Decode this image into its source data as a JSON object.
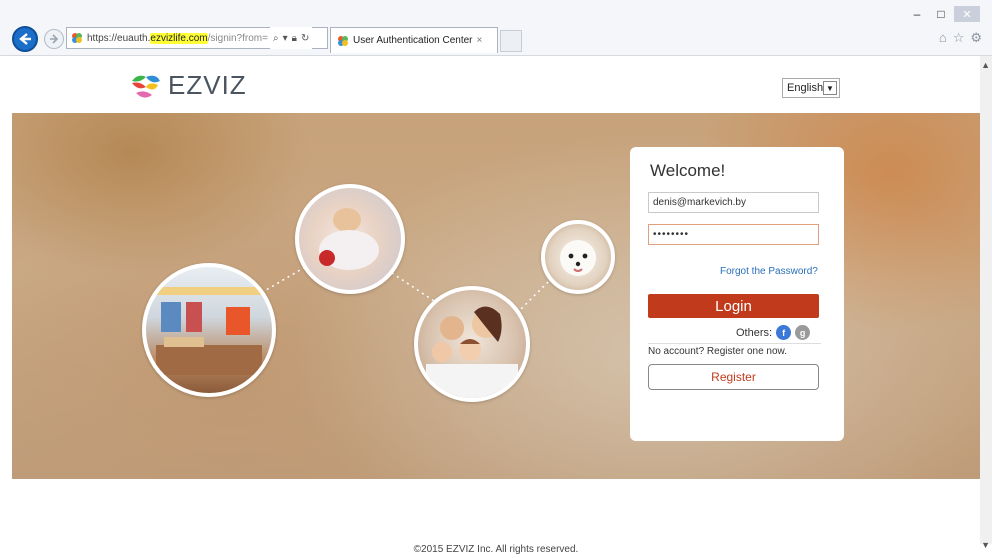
{
  "browser": {
    "url_prefix": "https://euauth.",
    "url_highlight": "ezvizlife.com",
    "url_suffix": "/signin?from=",
    "tab_title": "User Authentication Center",
    "tab_close": "×"
  },
  "header": {
    "logo_text": "EZVIZ",
    "language": "English"
  },
  "login": {
    "welcome": "Welcome!",
    "email_value": "denis@markevich.by",
    "password_mask": "••••••••",
    "forgot": "Forgot the Password?",
    "login_button": "Login",
    "others_label": "Others:",
    "no_account": "No account? Register one now.",
    "register_button": "Register"
  },
  "footer": {
    "copyright": "©2015  EZVIZ Inc. All rights reserved."
  },
  "colors": {
    "accent_red": "#c23a1c",
    "link_blue": "#2a6fb8",
    "facebook_blue": "#3b78d8",
    "gray_icon": "#9a9a9a"
  },
  "icons": [
    "back-arrow-icon",
    "forward-arrow-icon",
    "site-favicon",
    "search-icon",
    "lock-icon",
    "refresh-icon",
    "home-icon",
    "star-icon",
    "gear-icon",
    "facebook-icon",
    "google-plus-icon"
  ]
}
